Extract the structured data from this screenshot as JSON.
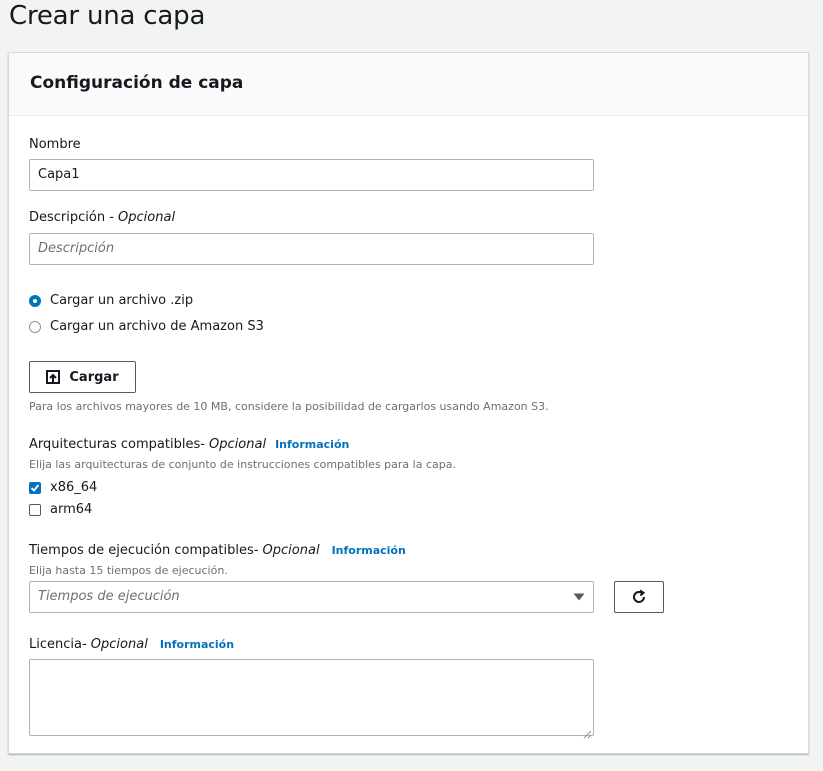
{
  "page": {
    "title": "Crear una capa"
  },
  "panel": {
    "title": "Configuración de capa"
  },
  "name_field": {
    "label": "Nombre",
    "value": "Capa1"
  },
  "description_field": {
    "label": "Descripción",
    "optional": " - Opcional",
    "placeholder": "Descripción"
  },
  "upload_source": {
    "options": [
      {
        "label": "Cargar un archivo .zip",
        "selected": true
      },
      {
        "label": "Cargar un archivo de Amazon S3",
        "selected": false
      }
    ]
  },
  "upload": {
    "button_label": "Cargar",
    "hint": "Para los archivos mayores de 10 MB, considere la posibilidad de cargarlos usando Amazon S3."
  },
  "architectures": {
    "label": "Arquitecturas compatibles",
    "optional": " - Opcional",
    "info": "Información",
    "hint": "Elija las arquitecturas de conjunto de instrucciones compatibles para la capa.",
    "options": [
      {
        "label": "x86_64",
        "checked": true
      },
      {
        "label": "arm64",
        "checked": false
      }
    ]
  },
  "runtimes": {
    "label": "Tiempos de ejecución compatibles",
    "optional": " - Opcional",
    "info": "Información",
    "hint": "Elija hasta 15 tiempos de ejecución.",
    "placeholder": "Tiempos de ejecución"
  },
  "license": {
    "label": "Licencia",
    "optional": " - Opcional",
    "info": "Información",
    "value": ""
  },
  "colors": {
    "accent": "#0073bb",
    "text": "#16191f",
    "muted": "#687078",
    "background": "#f2f3f3"
  },
  "icons": {
    "upload": "upload-icon",
    "refresh": "refresh-icon",
    "dropdown": "caret-down-icon"
  }
}
